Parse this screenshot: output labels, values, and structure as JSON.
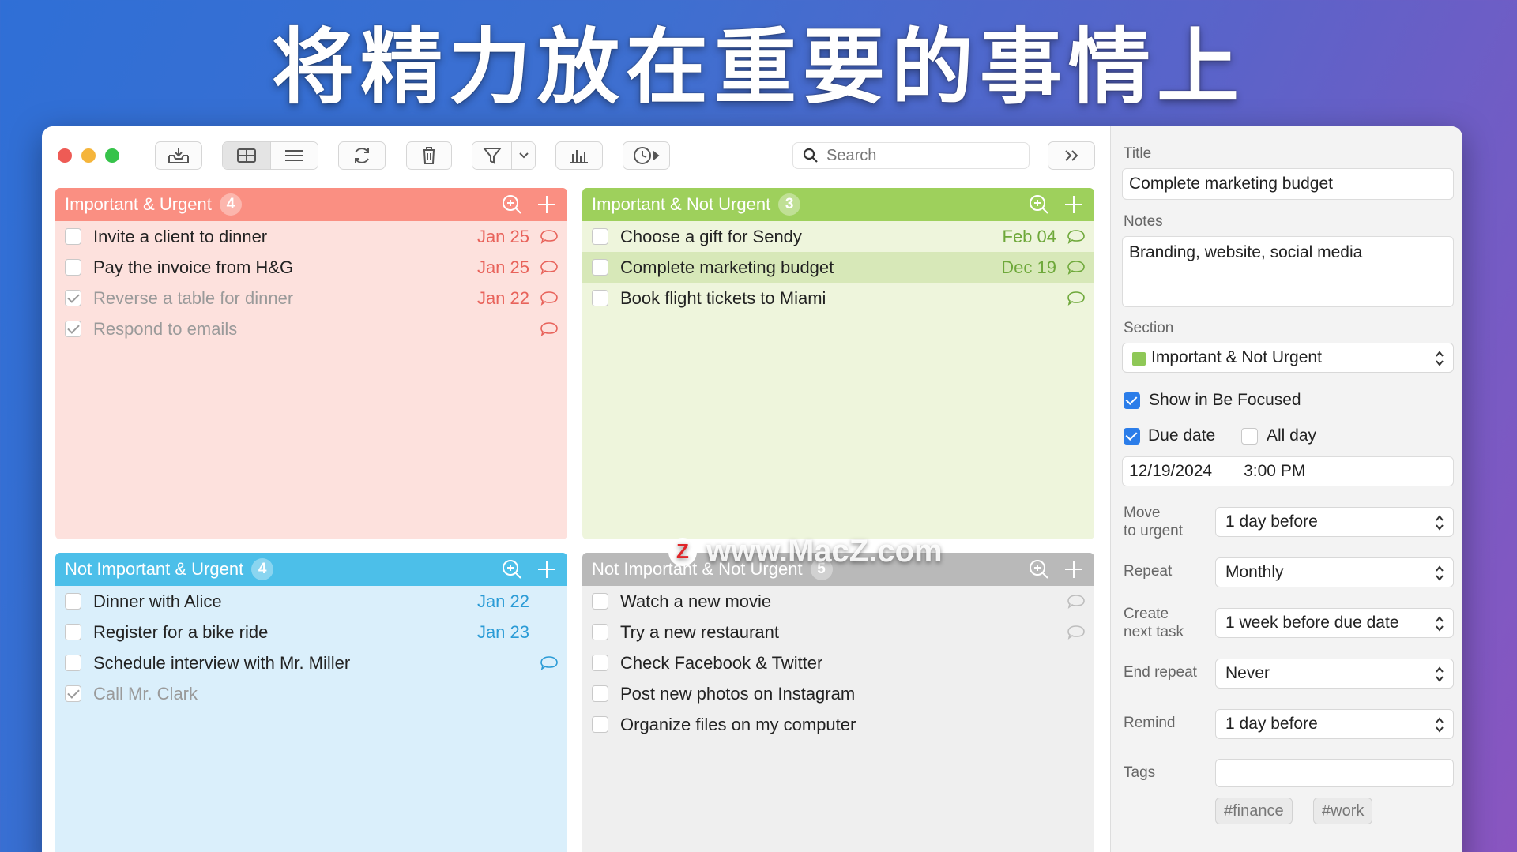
{
  "headline": "将精力放在重要的事情上",
  "colors": {
    "urgent_important": "#fa8f82",
    "urgent_important_body": "#fde1dd",
    "important_not_urgent": "#9ed05c",
    "important_not_urgent_body": "#eef5dc",
    "not_important_urgent": "#4cbfe9",
    "not_important_urgent_body": "#daeffb",
    "not_important_not_urgent": "#b9b9b9",
    "not_important_not_urgent_body": "#efefef"
  },
  "toolbar": {
    "search_placeholder": "Search"
  },
  "quadrants": {
    "iu": {
      "title": "Important & Urgent",
      "count": "4",
      "tasks": [
        {
          "label": "Invite a client to dinner",
          "date": "Jan 25",
          "done": false
        },
        {
          "label": "Pay the invoice from H&G",
          "date": "Jan 25",
          "done": false
        },
        {
          "label": "Reverse a table for dinner",
          "date": "Jan 22",
          "done": true
        },
        {
          "label": "Respond to emails",
          "date": "",
          "done": true
        }
      ]
    },
    "inu": {
      "title": "Important & Not Urgent",
      "count": "3",
      "tasks": [
        {
          "label": "Choose a gift for Sendy",
          "date": "Feb 04",
          "done": false
        },
        {
          "label": "Complete marketing budget",
          "date": "Dec 19",
          "done": false
        },
        {
          "label": "Book flight tickets to Miami",
          "date": "",
          "done": false
        }
      ]
    },
    "niu": {
      "title": "Not Important & Urgent",
      "count": "4",
      "tasks": [
        {
          "label": "Dinner with Alice",
          "date": "Jan 22",
          "done": false
        },
        {
          "label": "Register for a bike ride",
          "date": "Jan 23",
          "done": false
        },
        {
          "label": "Schedule interview with Mr. Miller",
          "date": "",
          "done": false
        },
        {
          "label": "Call Mr. Clark",
          "date": "",
          "done": true
        }
      ]
    },
    "ninu": {
      "title": "Not Important & Not Urgent",
      "count": "5",
      "tasks": [
        {
          "label": "Watch a new movie",
          "date": "",
          "done": false
        },
        {
          "label": "Try a new restaurant",
          "date": "",
          "done": false
        },
        {
          "label": "Check Facebook & Twitter",
          "date": "",
          "done": false
        },
        {
          "label": "Post new photos on Instagram",
          "date": "",
          "done": false
        },
        {
          "label": "Organize files on my computer",
          "date": "",
          "done": false
        }
      ]
    }
  },
  "watermark": {
    "logo": "Z",
    "text": "www.MacZ.com"
  },
  "detail": {
    "title_label": "Title",
    "title_value": "Complete marketing budget",
    "notes_label": "Notes",
    "notes_value": "Branding, website, social media",
    "section_label": "Section",
    "section_value": "Important & Not Urgent",
    "show_focused_label": "Show in Be Focused",
    "due_date_label": "Due date",
    "all_day_label": "All day",
    "due_date_value": "12/19/2024",
    "due_time_value": "3:00 PM",
    "move_label_1": "Move",
    "move_label_2": "to urgent",
    "move_value": "1 day before",
    "repeat_label": "Repeat",
    "repeat_value": "Monthly",
    "create_label_1": "Create",
    "create_label_2": "next task",
    "create_value": "1 week before due date",
    "end_repeat_label": "End repeat",
    "end_repeat_value": "Never",
    "remind_label": "Remind",
    "remind_value": "1 day before",
    "tags_label": "Tags",
    "tags": [
      "#finance",
      "#work"
    ]
  }
}
